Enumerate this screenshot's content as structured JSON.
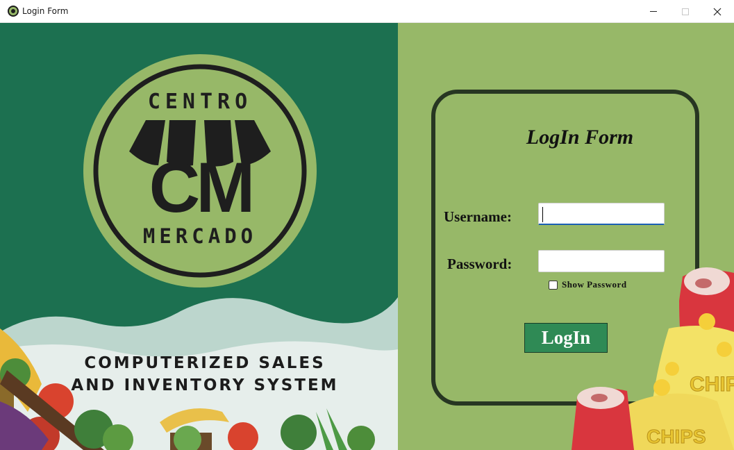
{
  "window": {
    "title": "Login Form",
    "icon": "centro-mercado-logo-icon",
    "controls": [
      "minimize-icon",
      "maximize-icon",
      "close-icon"
    ]
  },
  "branding": {
    "logo_top_text": "CENTRO",
    "logo_initials": "CM",
    "logo_bottom_text": "MERCADO",
    "system_title_line1": "COMPUTERIZED SALES",
    "system_title_line2": "AND INVENTORY SYSTEM"
  },
  "login": {
    "form_title": "LogIn Form",
    "username_label": "Username:",
    "username_value": "",
    "password_label": "Password:",
    "password_value": "",
    "show_password_label": "Show Password",
    "show_password_checked": false,
    "login_button_label": "LogIn"
  },
  "colors": {
    "left_background": "#1c7050",
    "right_background": "#97b868",
    "logo_green": "#97b868",
    "button_green": "#2f8a55",
    "card_border": "#273622"
  }
}
